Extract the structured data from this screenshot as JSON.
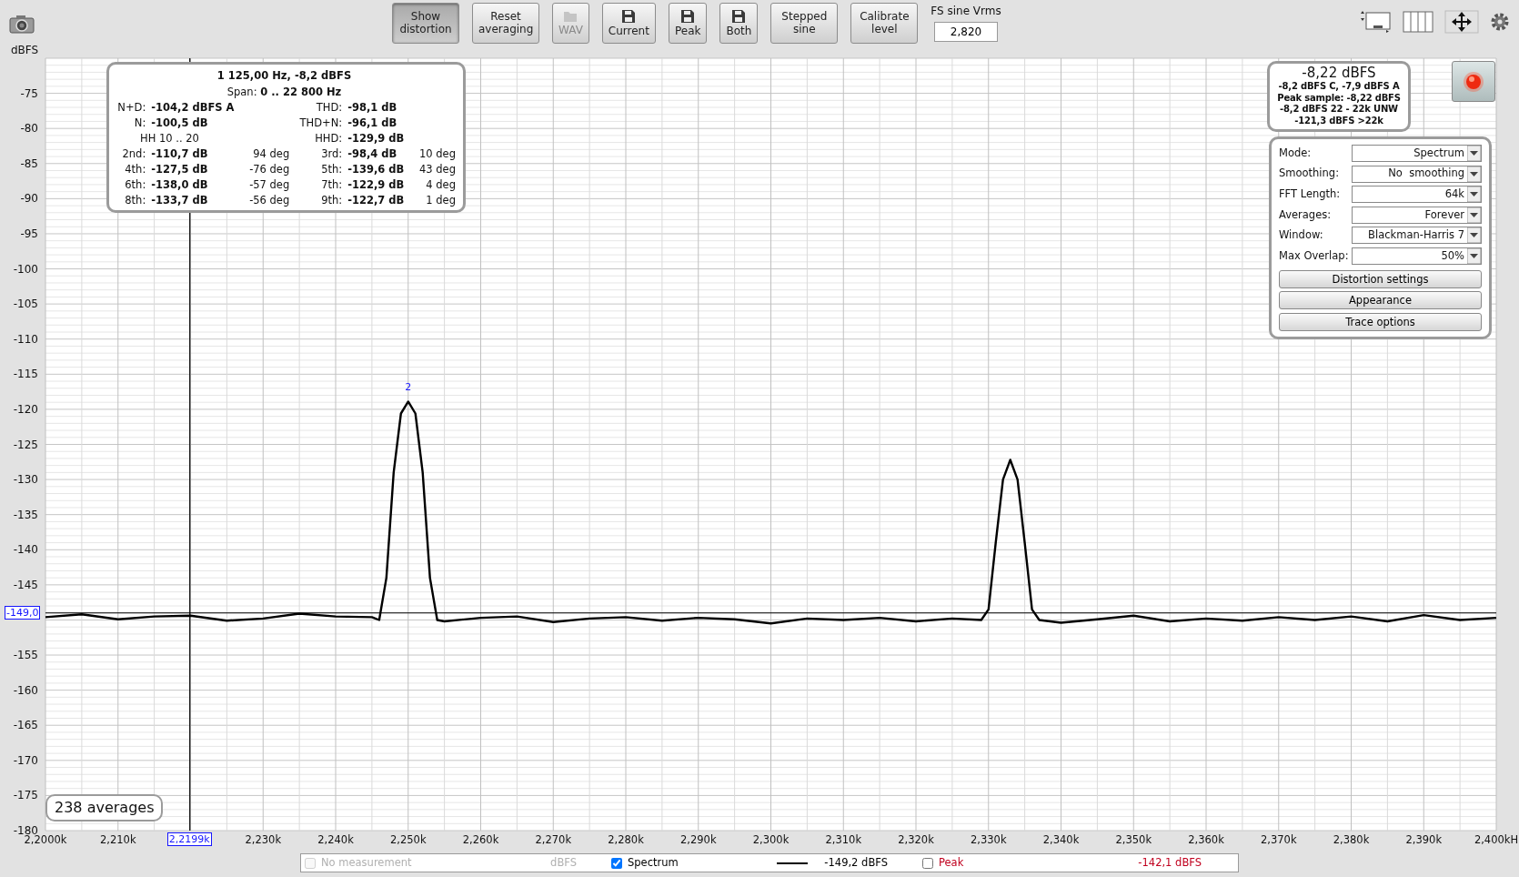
{
  "toolbar": {
    "buttons": [
      {
        "label": "Show distortion",
        "kind": "text",
        "pressed": true,
        "disabled": false
      },
      {
        "label": "Reset averaging",
        "kind": "text",
        "pressed": false,
        "disabled": false
      },
      {
        "label": "WAV",
        "kind": "folder",
        "pressed": false,
        "disabled": true
      },
      {
        "label": "Current",
        "kind": "save",
        "pressed": false,
        "disabled": false
      },
      {
        "label": "Peak",
        "kind": "save",
        "pressed": false,
        "disabled": false
      },
      {
        "label": "Both",
        "kind": "save",
        "pressed": false,
        "disabled": false
      },
      {
        "label": "Stepped sine",
        "kind": "text",
        "pressed": false,
        "disabled": false
      },
      {
        "label": "Calibrate level",
        "kind": "text",
        "pressed": false,
        "disabled": false
      }
    ],
    "fs_sine": {
      "label": "FS sine Vrms",
      "value": "2,820"
    }
  },
  "chart": {
    "chart_data": {
      "type": "line",
      "ylabel": "dBFS",
      "xlim": [
        2200,
        2400
      ],
      "ylim": [
        -180,
        -70
      ],
      "x": [
        2200,
        2205,
        2210,
        2215,
        2220,
        2225,
        2230,
        2235,
        2240,
        2245,
        2246,
        2247,
        2248,
        2249,
        2250,
        2251,
        2252,
        2253,
        2254,
        2255,
        2260,
        2265,
        2270,
        2275,
        2280,
        2285,
        2290,
        2295,
        2300,
        2305,
        2310,
        2315,
        2320,
        2325,
        2329,
        2330,
        2331,
        2332,
        2333,
        2334,
        2335,
        2336,
        2337,
        2340,
        2345,
        2350,
        2355,
        2360,
        2365,
        2370,
        2375,
        2380,
        2385,
        2390,
        2395,
        2400
      ],
      "series": [
        {
          "color": "#000000",
          "values": [
            -149.6,
            -149.2,
            -149.9,
            -149.5,
            -149.4,
            -150.1,
            -149.8,
            -149.1,
            -149.5,
            -149.6,
            -150.0,
            -144.0,
            -129.0,
            -120.6,
            -118.9,
            -120.6,
            -129.0,
            -144.0,
            -150.0,
            -150.2,
            -149.7,
            -149.5,
            -150.3,
            -149.8,
            -149.6,
            -150.1,
            -149.7,
            -149.9,
            -150.5,
            -149.8,
            -150.0,
            -149.7,
            -150.2,
            -149.8,
            -150.0,
            -148.5,
            -139.0,
            -130.0,
            -127.2,
            -130.0,
            -139.0,
            -148.5,
            -150.0,
            -150.4,
            -149.9,
            -149.4,
            -150.2,
            -149.8,
            -150.1,
            -149.6,
            -150.0,
            -149.5,
            -150.2,
            -149.3,
            -150.0,
            -149.7
          ]
        }
      ],
      "xticks": [
        {
          "value": 2200,
          "label": "2,2000k"
        },
        {
          "value": 2210,
          "label": "2,210k"
        },
        {
          "value": 2230,
          "label": "2,230k"
        },
        {
          "value": 2240,
          "label": "2,240k"
        },
        {
          "value": 2250,
          "label": "2,250k"
        },
        {
          "value": 2260,
          "label": "2,260k"
        },
        {
          "value": 2270,
          "label": "2,270k"
        },
        {
          "value": 2280,
          "label": "2,280k"
        },
        {
          "value": 2290,
          "label": "2,290k"
        },
        {
          "value": 2300,
          "label": "2,300k"
        },
        {
          "value": 2310,
          "label": "2,310k"
        },
        {
          "value": 2320,
          "label": "2,320k"
        },
        {
          "value": 2330,
          "label": "2,330k"
        },
        {
          "value": 2340,
          "label": "2,340k"
        },
        {
          "value": 2350,
          "label": "2,350k"
        },
        {
          "value": 2360,
          "label": "2,360k"
        },
        {
          "value": 2370,
          "label": "2,370k"
        },
        {
          "value": 2380,
          "label": "2,380k"
        },
        {
          "value": 2390,
          "label": "2,390k"
        },
        {
          "value": 2400,
          "label": "2,400kH"
        }
      ],
      "yticks": [
        -75,
        -80,
        -85,
        -90,
        -95,
        -100,
        -105,
        -110,
        -115,
        -120,
        -125,
        -130,
        -135,
        -140,
        -145,
        -155,
        -160,
        -165,
        -170,
        -175,
        -180
      ],
      "annotations": [
        {
          "x": 2250,
          "y": -118.9,
          "text": "2"
        }
      ],
      "ref_lines": [
        {
          "axis": "x",
          "value": 2219.9,
          "label": "2,2199k"
        },
        {
          "axis": "y",
          "value": -149.0,
          "label": "-149,0"
        }
      ],
      "grid": true
    }
  },
  "distortion_panel": {
    "title": "1 125,00 Hz, -8,2 dBFS",
    "span_label": "Span:",
    "span_value": "0 .. 22 800 Hz",
    "rows": [
      {
        "left": {
          "label": "N+D:",
          "value": "-104,2 dBFS A"
        },
        "right": {
          "label": "THD:",
          "value": "-98,1 dB"
        }
      },
      {
        "left": {
          "label": "N:",
          "value": "-100,5 dB"
        },
        "right": {
          "label": "THD+N:",
          "value": "-96,1 dB"
        }
      },
      {
        "left": {
          "label": "HH 10 .. 20"
        },
        "right": {
          "label": "HHD:",
          "value": "-129,9 dB"
        }
      },
      {
        "left": {
          "label": "2nd:",
          "value": "-110,7 dB",
          "phase": "94 deg"
        },
        "right": {
          "label": "3rd:",
          "value": "-98,4 dB",
          "phase": "10 deg"
        }
      },
      {
        "left": {
          "label": "4th:",
          "value": "-127,5 dB",
          "phase": "-76 deg"
        },
        "right": {
          "label": "5th:",
          "value": "-139,6 dB",
          "phase": "43 deg"
        }
      },
      {
        "left": {
          "label": "6th:",
          "value": "-138,0 dB",
          "phase": "-57 deg"
        },
        "right": {
          "label": "7th:",
          "value": "-122,9 dB",
          "phase": "4 deg"
        }
      },
      {
        "left": {
          "label": "8th:",
          "value": "-133,7 dB",
          "phase": "-56 deg"
        },
        "right": {
          "label": "9th:",
          "value": "-122,7 dB",
          "phase": "1 deg"
        }
      }
    ]
  },
  "level_panel": {
    "main": "-8,22 dBFS",
    "lines": [
      "-8,2 dBFS C, -7,9 dBFS A",
      "Peak sample: -8,22 dBFS",
      "-8,2 dBFS 22 - 22k UNW",
      "-121,3 dBFS >22k"
    ]
  },
  "settings_panel": {
    "fields": [
      {
        "label": "Mode:",
        "value": "Spectrum"
      },
      {
        "label": "Smoothing:",
        "value": "No  smoothing"
      },
      {
        "label": "FFT Length:",
        "value": "64k"
      },
      {
        "label": "Averages:",
        "value": "Forever"
      },
      {
        "label": "Window:",
        "value": "Blackman-Harris 7"
      },
      {
        "label": "Max Overlap:",
        "value": "50%"
      }
    ],
    "buttons": [
      "Distortion settings",
      "Appearance",
      "Trace options"
    ]
  },
  "averages": "238 averages",
  "legend": [
    {
      "label": "No measurement",
      "reading": "dBFS",
      "checked": false,
      "disabled": true
    },
    {
      "label": "Spectrum",
      "reading": "-149,2 dBFS",
      "checked": true,
      "disabled": false,
      "color": "#000000"
    },
    {
      "label": "Peak",
      "reading": "-142,1 dBFS",
      "checked": false,
      "disabled": false,
      "color": "#c0001e"
    }
  ]
}
